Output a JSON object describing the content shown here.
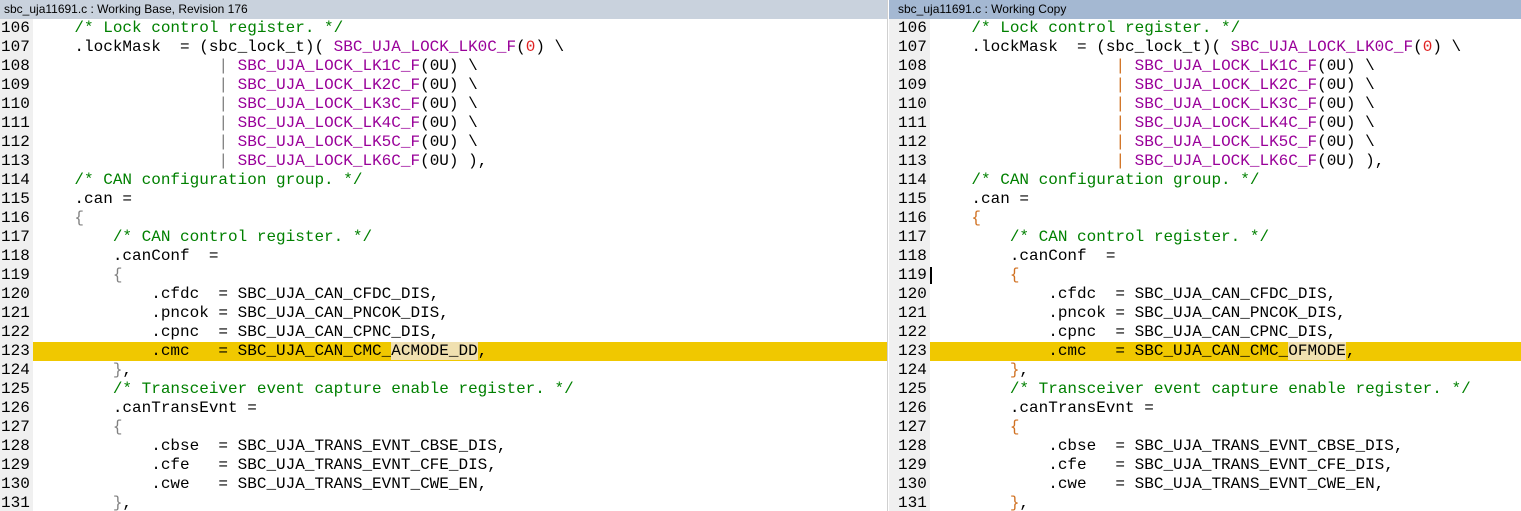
{
  "left": {
    "title": "sbc_uja11691.c : Working Base, Revision 176",
    "highlight_line": "123",
    "changed": "ACMODE_DD"
  },
  "right": {
    "title": "sbc_uja11691.c : Working Copy",
    "highlight_line": "123",
    "changed": "OFMODE",
    "caret_line": "119"
  },
  "lines": [
    {
      "n": "106",
      "s": [
        [
          "n",
          "    "
        ],
        [
          "cm",
          "/* Lock control register. */"
        ]
      ]
    },
    {
      "n": "107",
      "s": [
        [
          "n",
          "    .lockMask  = (sbc_lock_t)( "
        ],
        [
          "mac",
          "SBC_UJA_LOCK_LK0C_F"
        ],
        [
          "n",
          "("
        ],
        [
          "num0",
          "0"
        ],
        [
          "n",
          ") \\"
        ]
      ]
    },
    {
      "n": "108",
      "s": [
        [
          "n",
          "                   "
        ],
        [
          "op",
          "|"
        ],
        [
          "n",
          " "
        ],
        [
          "mac",
          "SBC_UJA_LOCK_LK1C_F"
        ],
        [
          "n",
          "(0U) \\"
        ]
      ]
    },
    {
      "n": "109",
      "s": [
        [
          "n",
          "                   "
        ],
        [
          "op",
          "|"
        ],
        [
          "n",
          " "
        ],
        [
          "mac",
          "SBC_UJA_LOCK_LK2C_F"
        ],
        [
          "n",
          "(0U) \\"
        ]
      ]
    },
    {
      "n": "110",
      "s": [
        [
          "n",
          "                   "
        ],
        [
          "op",
          "|"
        ],
        [
          "n",
          " "
        ],
        [
          "mac",
          "SBC_UJA_LOCK_LK3C_F"
        ],
        [
          "n",
          "(0U) \\"
        ]
      ]
    },
    {
      "n": "111",
      "s": [
        [
          "n",
          "                   "
        ],
        [
          "op",
          "|"
        ],
        [
          "n",
          " "
        ],
        [
          "mac",
          "SBC_UJA_LOCK_LK4C_F"
        ],
        [
          "n",
          "(0U) \\"
        ]
      ]
    },
    {
      "n": "112",
      "s": [
        [
          "n",
          "                   "
        ],
        [
          "op",
          "|"
        ],
        [
          "n",
          " "
        ],
        [
          "mac",
          "SBC_UJA_LOCK_LK5C_F"
        ],
        [
          "n",
          "(0U) \\"
        ]
      ]
    },
    {
      "n": "113",
      "s": [
        [
          "n",
          "                   "
        ],
        [
          "op",
          "|"
        ],
        [
          "n",
          " "
        ],
        [
          "mac",
          "SBC_UJA_LOCK_LK6C_F"
        ],
        [
          "n",
          "(0U) ),"
        ]
      ]
    },
    {
      "n": "114",
      "s": [
        [
          "n",
          "    "
        ],
        [
          "cm",
          "/* CAN configuration group. */"
        ]
      ]
    },
    {
      "n": "115",
      "s": [
        [
          "n",
          "    .can ="
        ]
      ]
    },
    {
      "n": "116",
      "s": [
        [
          "n",
          "    "
        ],
        [
          "op",
          "{"
        ]
      ]
    },
    {
      "n": "117",
      "s": [
        [
          "n",
          "        "
        ],
        [
          "cm",
          "/* CAN control register. */"
        ]
      ]
    },
    {
      "n": "118",
      "s": [
        [
          "n",
          "        .canConf  ="
        ]
      ]
    },
    {
      "n": "119",
      "s": [
        [
          "n",
          "        "
        ],
        [
          "op",
          "{"
        ]
      ]
    },
    {
      "n": "120",
      "s": [
        [
          "n",
          "            .cfdc  = SBC_UJA_CAN_CFDC_DIS,"
        ]
      ]
    },
    {
      "n": "121",
      "s": [
        [
          "n",
          "            .pncok = SBC_UJA_CAN_PNCOK_DIS,"
        ]
      ]
    },
    {
      "n": "122",
      "s": [
        [
          "n",
          "            .cpnc  = SBC_UJA_CAN_CPNC_DIS,"
        ]
      ]
    },
    {
      "n": "123",
      "diff": true,
      "s": [
        [
          "n",
          "            .cmc   = SBC_UJA_CAN_CMC_"
        ]
      ]
    },
    {
      "n": "124",
      "s": [
        [
          "n",
          "        "
        ],
        [
          "op",
          "}"
        ],
        [
          "n",
          ","
        ]
      ]
    },
    {
      "n": "125",
      "s": [
        [
          "n",
          "        "
        ],
        [
          "cm",
          "/* Transceiver event capture enable register. */"
        ]
      ]
    },
    {
      "n": "126",
      "s": [
        [
          "n",
          "        .canTransEvnt ="
        ]
      ]
    },
    {
      "n": "127",
      "s": [
        [
          "n",
          "        "
        ],
        [
          "op",
          "{"
        ]
      ]
    },
    {
      "n": "128",
      "s": [
        [
          "n",
          "            .cbse  = SBC_UJA_TRANS_EVNT_CBSE_DIS,"
        ]
      ]
    },
    {
      "n": "129",
      "s": [
        [
          "n",
          "            .cfe   = SBC_UJA_TRANS_EVNT_CFE_DIS,"
        ]
      ]
    },
    {
      "n": "130",
      "s": [
        [
          "n",
          "            .cwe   = SBC_UJA_TRANS_EVNT_CWE_EN,"
        ]
      ]
    },
    {
      "n": "131",
      "s": [
        [
          "n",
          "        "
        ],
        [
          "op",
          "}"
        ],
        [
          "n",
          ","
        ]
      ]
    }
  ]
}
